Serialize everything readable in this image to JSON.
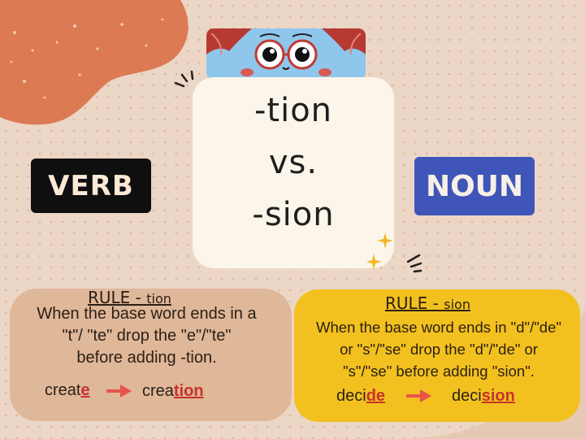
{
  "center": {
    "line1": "-tion",
    "line2": "vs.",
    "line3": "-sion"
  },
  "verb_label": "VERB",
  "noun_label": "NOUN",
  "rule_tion": {
    "title_main": "RULE - ",
    "title_suffix": "tion",
    "line1": "When the base word ends in a",
    "line2": "\"t\"/ \"te\" drop the \"e\"/\"te\"",
    "line3": "before adding -tion.",
    "example_from_stem": "creat",
    "example_from_hl": "e",
    "example_to_stem": "crea",
    "example_to_hl": "tion"
  },
  "rule_sion": {
    "title_main": "RULE - ",
    "title_suffix": "sion",
    "line1": "When the base word ends in \"d\"/\"de\"",
    "line2": "or \"s\"/\"se\" drop the \"d\"/\"de\" or",
    "line3": "\"s\"/\"se\" before adding \"sion\".",
    "example_from_stem": "deci",
    "example_from_hl": "de",
    "example_to_stem": "deci",
    "example_to_hl": "sion"
  },
  "colors": {
    "background": "#ecd6c6",
    "blob": "#dc7a54",
    "card": "#fbf5ea",
    "verb_bg": "#0f0f0f",
    "noun_bg": "#4055b8",
    "rule_tion_bg": "#dfb799",
    "rule_sion_bg": "#f2c11f",
    "highlight": "#c7322a",
    "arrow": "#e8544a"
  }
}
